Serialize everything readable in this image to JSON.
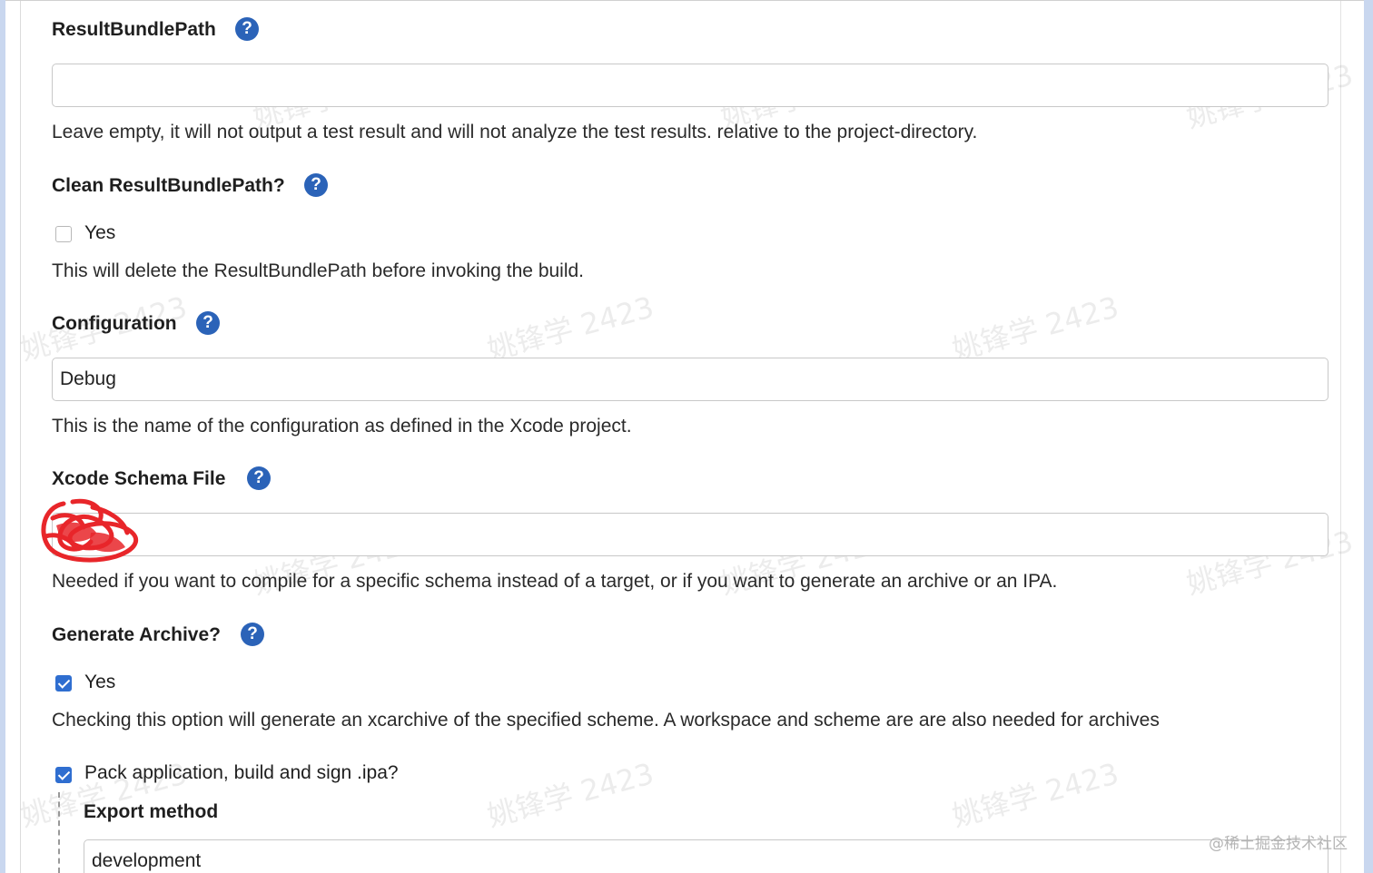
{
  "watermark": "姚锋学 2423",
  "footer_watermark": "@稀土掘金技术社区",
  "help_glyph": "?",
  "fields": {
    "result_bundle_path": {
      "label": "ResultBundlePath",
      "value": "",
      "description": "Leave empty, it will not output a test result and will not analyze the test results. relative to the project-directory."
    },
    "clean_result_bundle_path": {
      "label": "Clean ResultBundlePath?",
      "checkbox_label": "Yes",
      "checked": false,
      "description": "This will delete the ResultBundlePath before invoking the build."
    },
    "configuration": {
      "label": "Configuration",
      "value": "Debug",
      "description": "This is the name of the configuration as defined in the Xcode project."
    },
    "xcode_schema_file": {
      "label": "Xcode Schema File",
      "value": "",
      "description": "Needed if you want to compile for a specific schema instead of a target, or if you want to generate an archive or an IPA."
    },
    "generate_archive": {
      "label": "Generate Archive?",
      "checkbox_label": "Yes",
      "checked": true,
      "description": "Checking this option will generate an xcarchive of the specified scheme. A workspace and scheme are are also needed for archives"
    },
    "pack_application": {
      "checkbox_label": "Pack application, build and sign .ipa?",
      "checked": true
    },
    "export_method": {
      "label": "Export method",
      "value": "development"
    }
  },
  "colors": {
    "help_icon": "#2b63b8",
    "checkbox_checked": "#2f6ed0",
    "scribble": "#e8262a"
  }
}
